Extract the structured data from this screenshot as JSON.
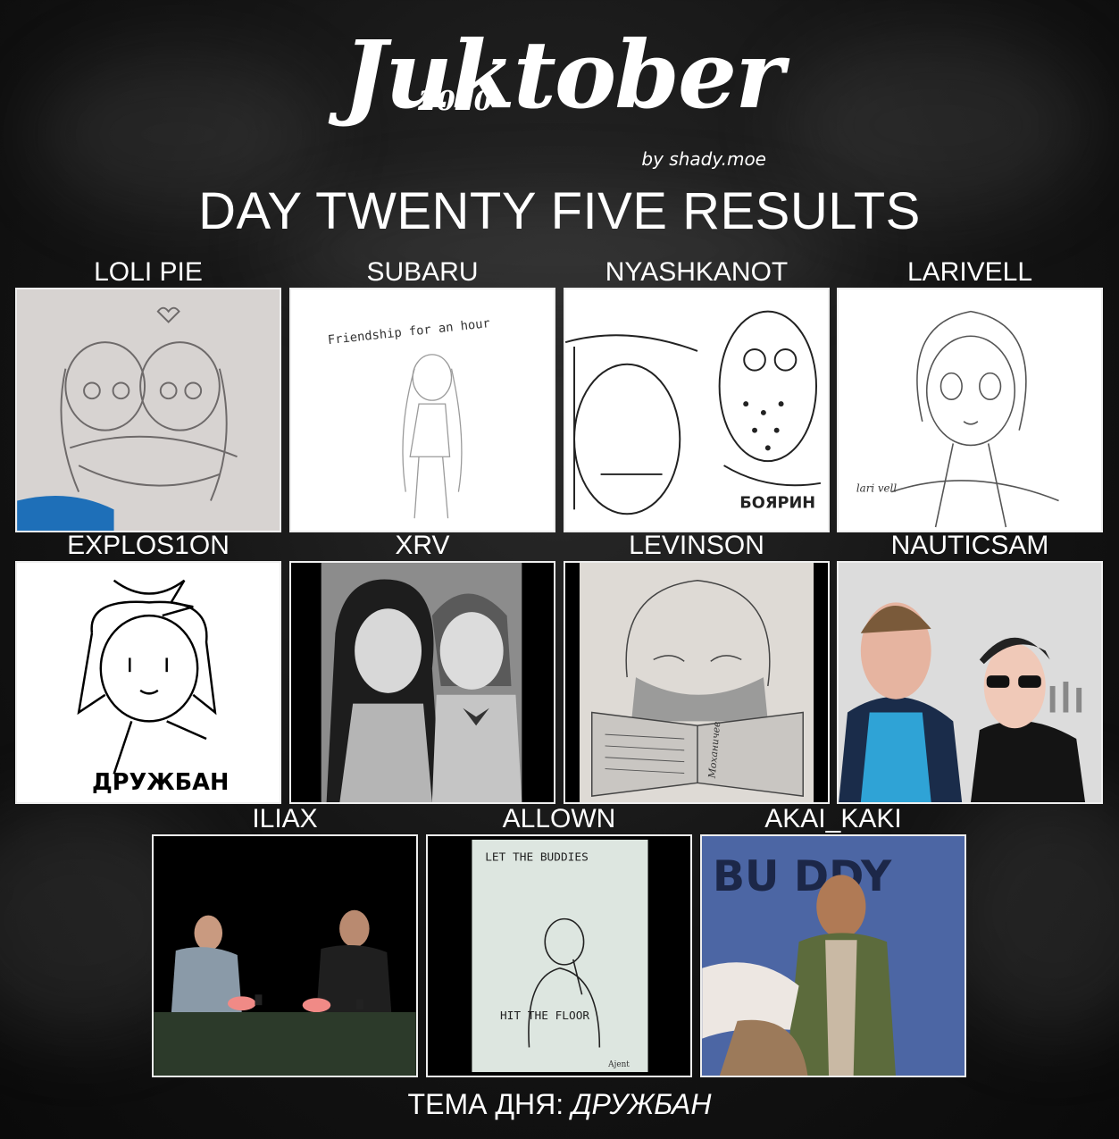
{
  "logo": {
    "year": "2020",
    "title": "Juktober",
    "byline": "by shady.moe"
  },
  "heading": "DAY TWENTY FIVE RESULTS",
  "entries": [
    {
      "name": "LOLI PIE",
      "art": "pencil-sketch-two-girls-hugging"
    },
    {
      "name": "SUBARU",
      "art": "line-sketch-girl",
      "caption": "Friendship for an hour"
    },
    {
      "name": "NYASHKANOT",
      "art": "sketch-freddy-and-jason",
      "badge": "БОЯРИН"
    },
    {
      "name": "LARIVELL",
      "art": "sketch-girl-portrait",
      "signature": "lari vell"
    },
    {
      "name": "EXPLOS1ON",
      "art": "doodle-chibi-girl",
      "caption": "ДРУЖБАН"
    },
    {
      "name": "XRV",
      "art": "grayscale-two-schoolgirls"
    },
    {
      "name": "LEVINSON",
      "art": "ink-girl-with-book",
      "book_text": "Моханичев"
    },
    {
      "name": "NAUTICSAM",
      "art": "painted-two-men"
    },
    {
      "name": "ILIAX",
      "art": "flat-two-men-at-table"
    },
    {
      "name": "ALLOWN",
      "art": "ink-sketch-man-with-mic",
      "top_text": "LET THE BUDDIES",
      "bottom_text": "HIT THE FLOOR",
      "signature": "Ajent"
    },
    {
      "name": "AKAI_KAKI",
      "art": "painted-man-buddy",
      "caption": "BU DDY"
    }
  ],
  "footer": {
    "prefix": "ТЕМА ДНЯ: ",
    "theme": "ДРУЖБАН"
  },
  "colors": {
    "background": "#141414",
    "text": "#ffffff",
    "frame": "#eeeeee"
  }
}
